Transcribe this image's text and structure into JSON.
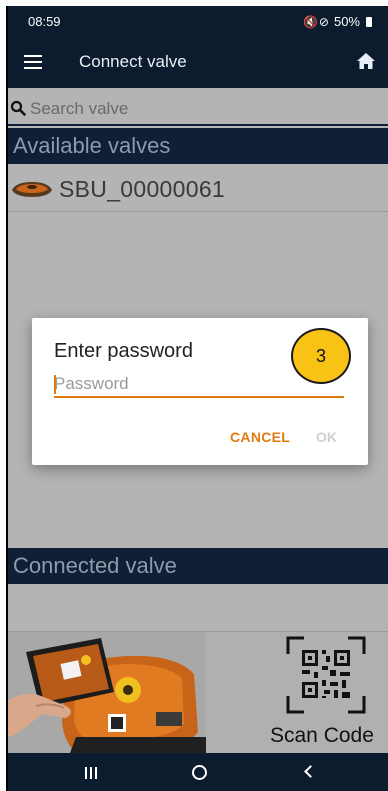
{
  "status_bar": {
    "time": "08:59",
    "icons": "🔇⊘",
    "battery": "50%"
  },
  "app_bar": {
    "title": "Connect valve",
    "menu_icon": "hamburger-menu-icon",
    "home_icon": "home-icon"
  },
  "search": {
    "placeholder": "Search valve",
    "icon": "search-icon"
  },
  "available": {
    "header": "Available valves",
    "items": [
      {
        "label": "SBU_00000061",
        "icon": "valve-icon"
      }
    ]
  },
  "connected": {
    "header": "Connected valve"
  },
  "scan": {
    "label": "Scan Code",
    "icon": "qr-code-icon"
  },
  "dialog": {
    "title": "Enter password",
    "password_placeholder": "Password",
    "cancel_label": "CANCEL",
    "ok_label": "OK"
  },
  "badge": {
    "value": "3"
  },
  "colors": {
    "app_bar_bg": "#0d1b2e",
    "accent": "#e07b12",
    "badge_fill": "#f9c316",
    "dimmed_content": "#b4b4b4"
  }
}
